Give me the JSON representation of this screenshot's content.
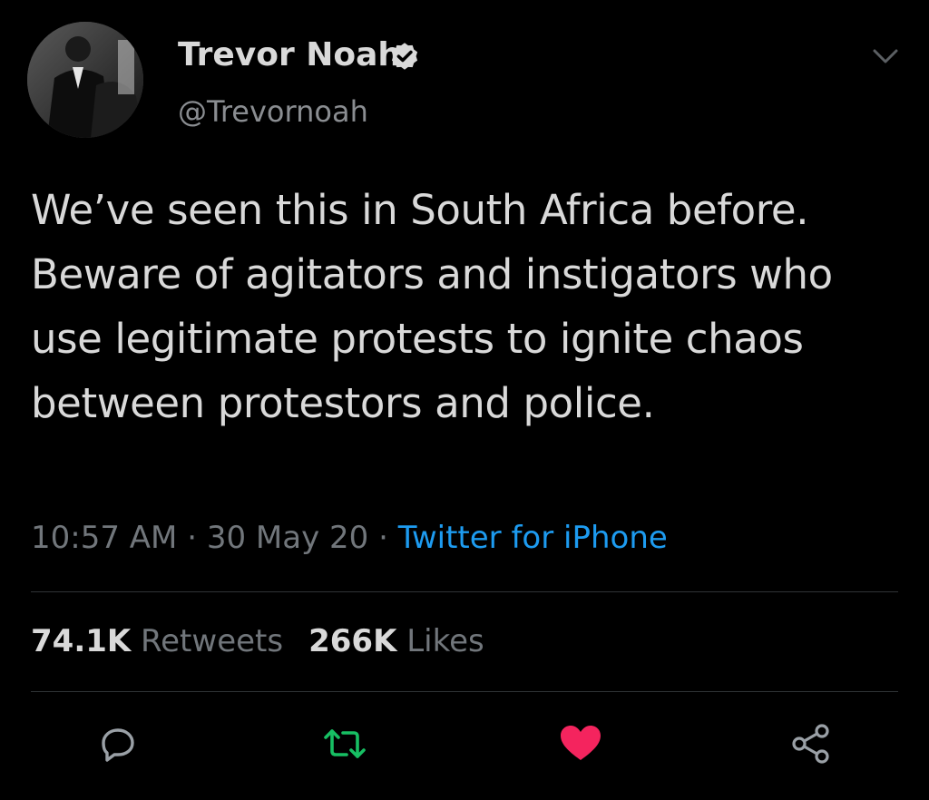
{
  "author": {
    "display_name": "Trevor Noah",
    "handle": "@Trevornoah",
    "verified": true
  },
  "tweet": {
    "text": "We’ve seen this in South Africa before. Beware of agitators and instigators who use legitimate protests to ignite chaos between protestors and police.",
    "time": "10:57 AM",
    "separator": " · ",
    "date": "30 May 20",
    "source": "Twitter for iPhone"
  },
  "stats": {
    "retweets_count": "74.1K",
    "retweets_label": "Retweets",
    "likes_count": "266K",
    "likes_label": "Likes"
  },
  "actions": [
    {
      "icon": "reply-icon"
    },
    {
      "icon": "retweet-icon"
    },
    {
      "icon": "like-icon"
    },
    {
      "icon": "share-icon"
    }
  ],
  "colors": {
    "background": "#000000",
    "text": "#d9d9d9",
    "muted": "#71767b",
    "link": "#1d9bf0",
    "retweet": "#17bf63",
    "like": "#f4245e"
  }
}
